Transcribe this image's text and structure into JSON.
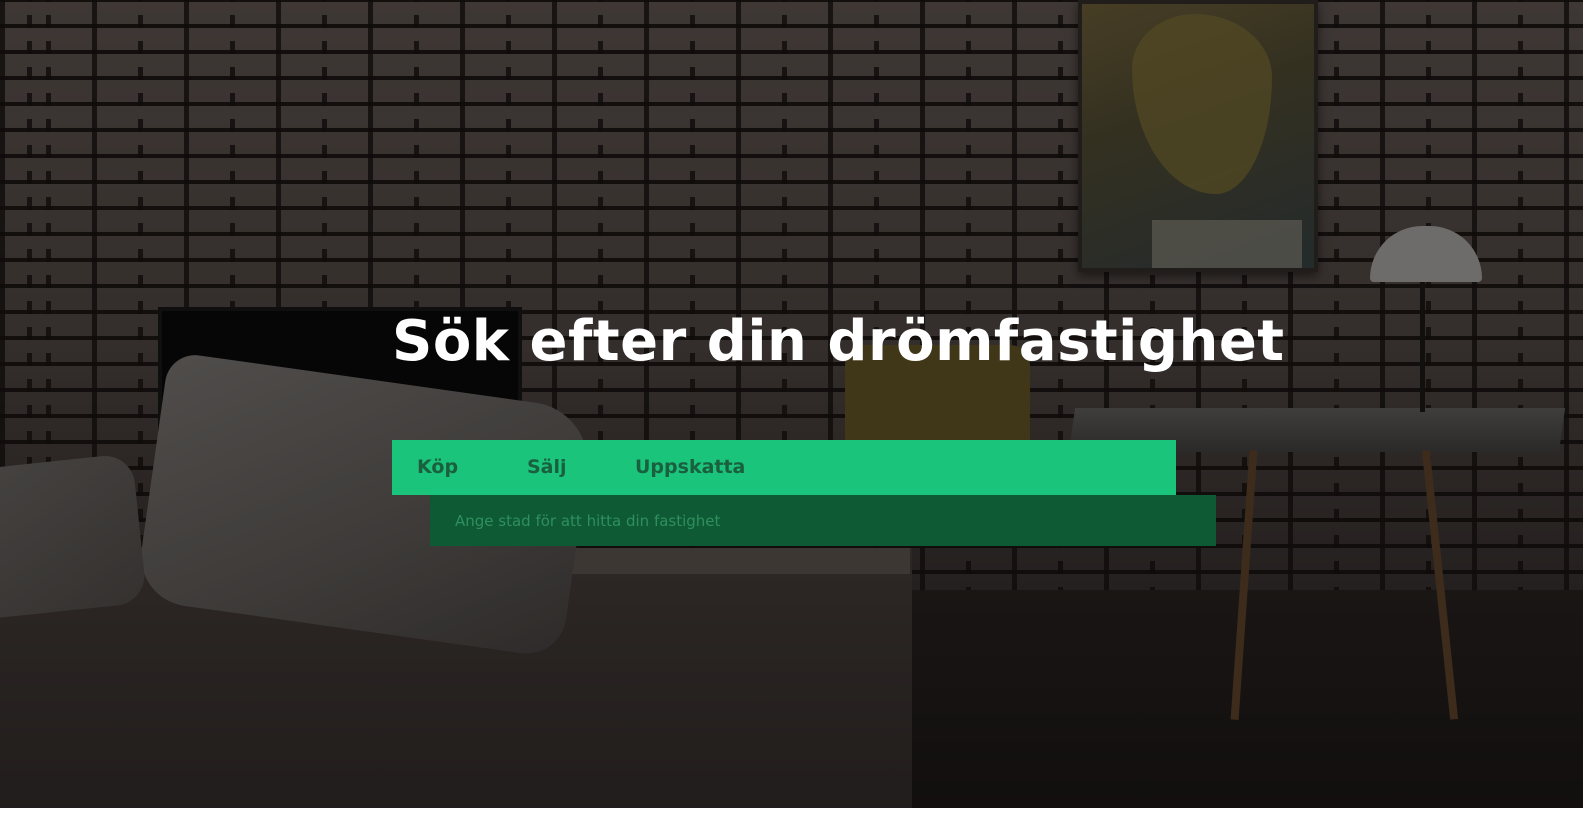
{
  "hero": {
    "title": "Sök efter din drömfastighet"
  },
  "tabs": [
    {
      "label": "Köp"
    },
    {
      "label": "Sälj"
    },
    {
      "label": "Uppskatta"
    }
  ],
  "search": {
    "placeholder": "Ange stad för att hitta din fastighet",
    "value": ""
  },
  "colors": {
    "tab_bar": "#1ac47a",
    "tab_text": "#1a5f3f",
    "search_bg": "#0e5a35",
    "headline": "#ffffff"
  }
}
